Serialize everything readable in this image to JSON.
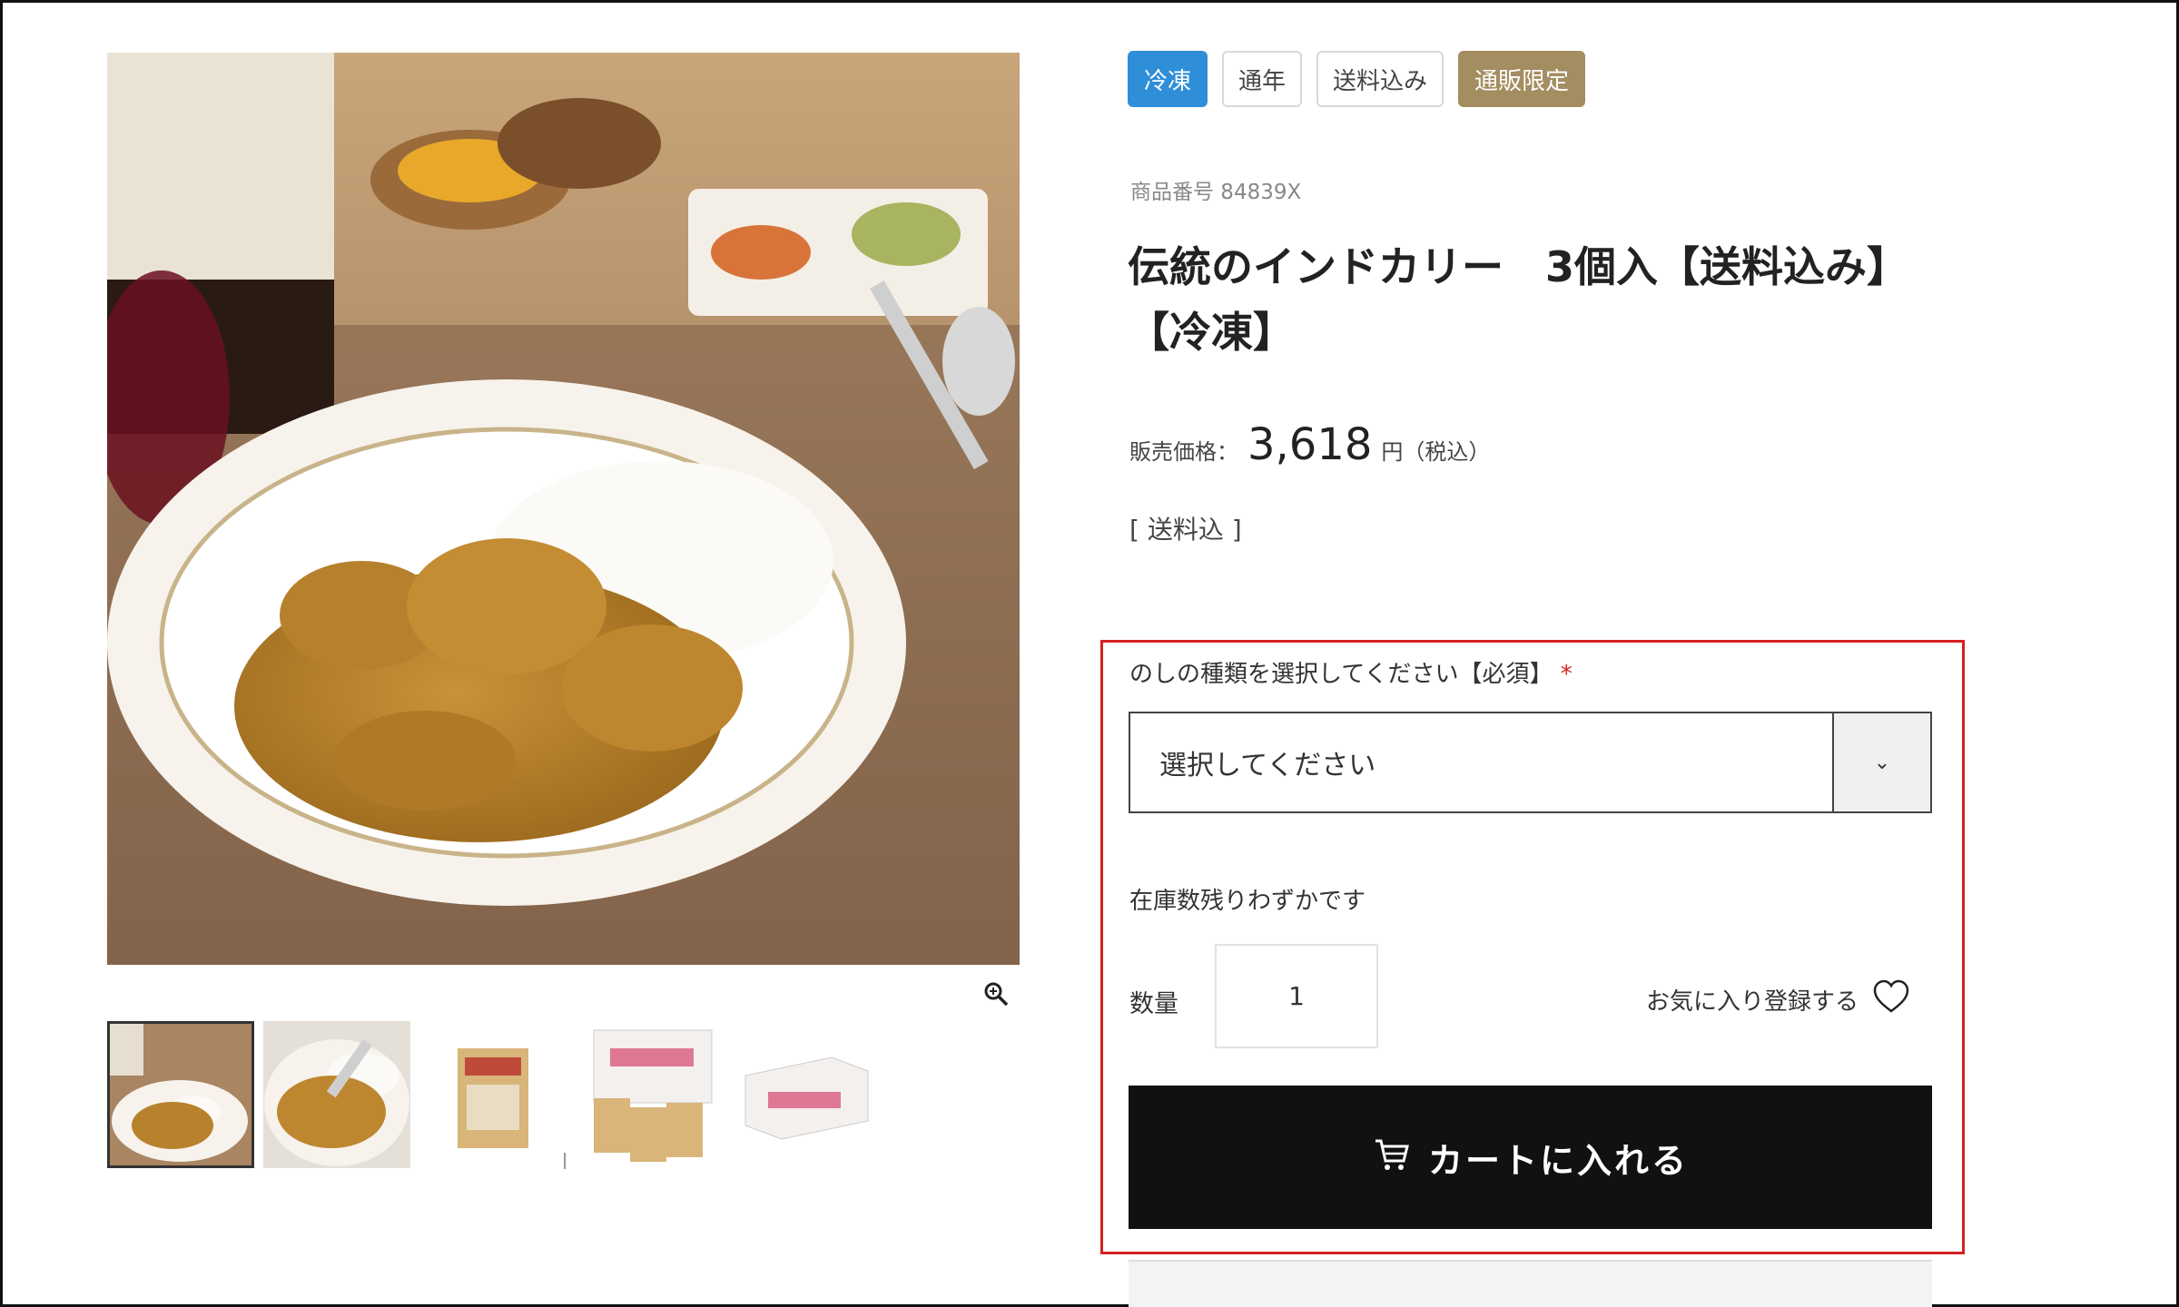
{
  "tags": [
    {
      "label": "冷凍",
      "color": "#2f8ed8"
    },
    {
      "label": "通年",
      "color": "#ffffff"
    },
    {
      "label": "送料込み",
      "color": "#ffffff"
    },
    {
      "label": "通販限定",
      "color": "#a48d60"
    }
  ],
  "product": {
    "sku": "商品番号 84839X",
    "title_line1": "伝統のインドカリー　3個入【送料込み】",
    "title_line2": "【冷凍】",
    "price_label": "販売価格：",
    "price": "3,618",
    "price_unit": "円（税込）",
    "shipping_note": "[ 送料込 ]"
  },
  "noshi": {
    "label": "のしの種類を選択してください【必須】",
    "required_mark": "*",
    "selected": "選択してください"
  },
  "stock_note": "在庫数残りわずかです",
  "quantity": {
    "label": "数量",
    "value": "1"
  },
  "favorite": {
    "label": "お気に入り登録する",
    "icon": "heart-outline-icon"
  },
  "cart": {
    "label": "カートに入れる",
    "icon": "cart-icon"
  },
  "gallery": {
    "main_image": "curry-plate-photo",
    "thumbnails": [
      "curry-plate-thumbnail",
      "curry-spoon-thumbnail",
      "curry-pouch-thumbnail",
      "curry-box-set-thumbnail",
      "curry-box-thumbnail"
    ],
    "zoom_icon": "zoom-in-icon"
  },
  "colors": {
    "highlight": "#d62020",
    "cart_button": "#111111",
    "accent_blue": "#2f8ed8",
    "accent_gold": "#a48d60"
  }
}
